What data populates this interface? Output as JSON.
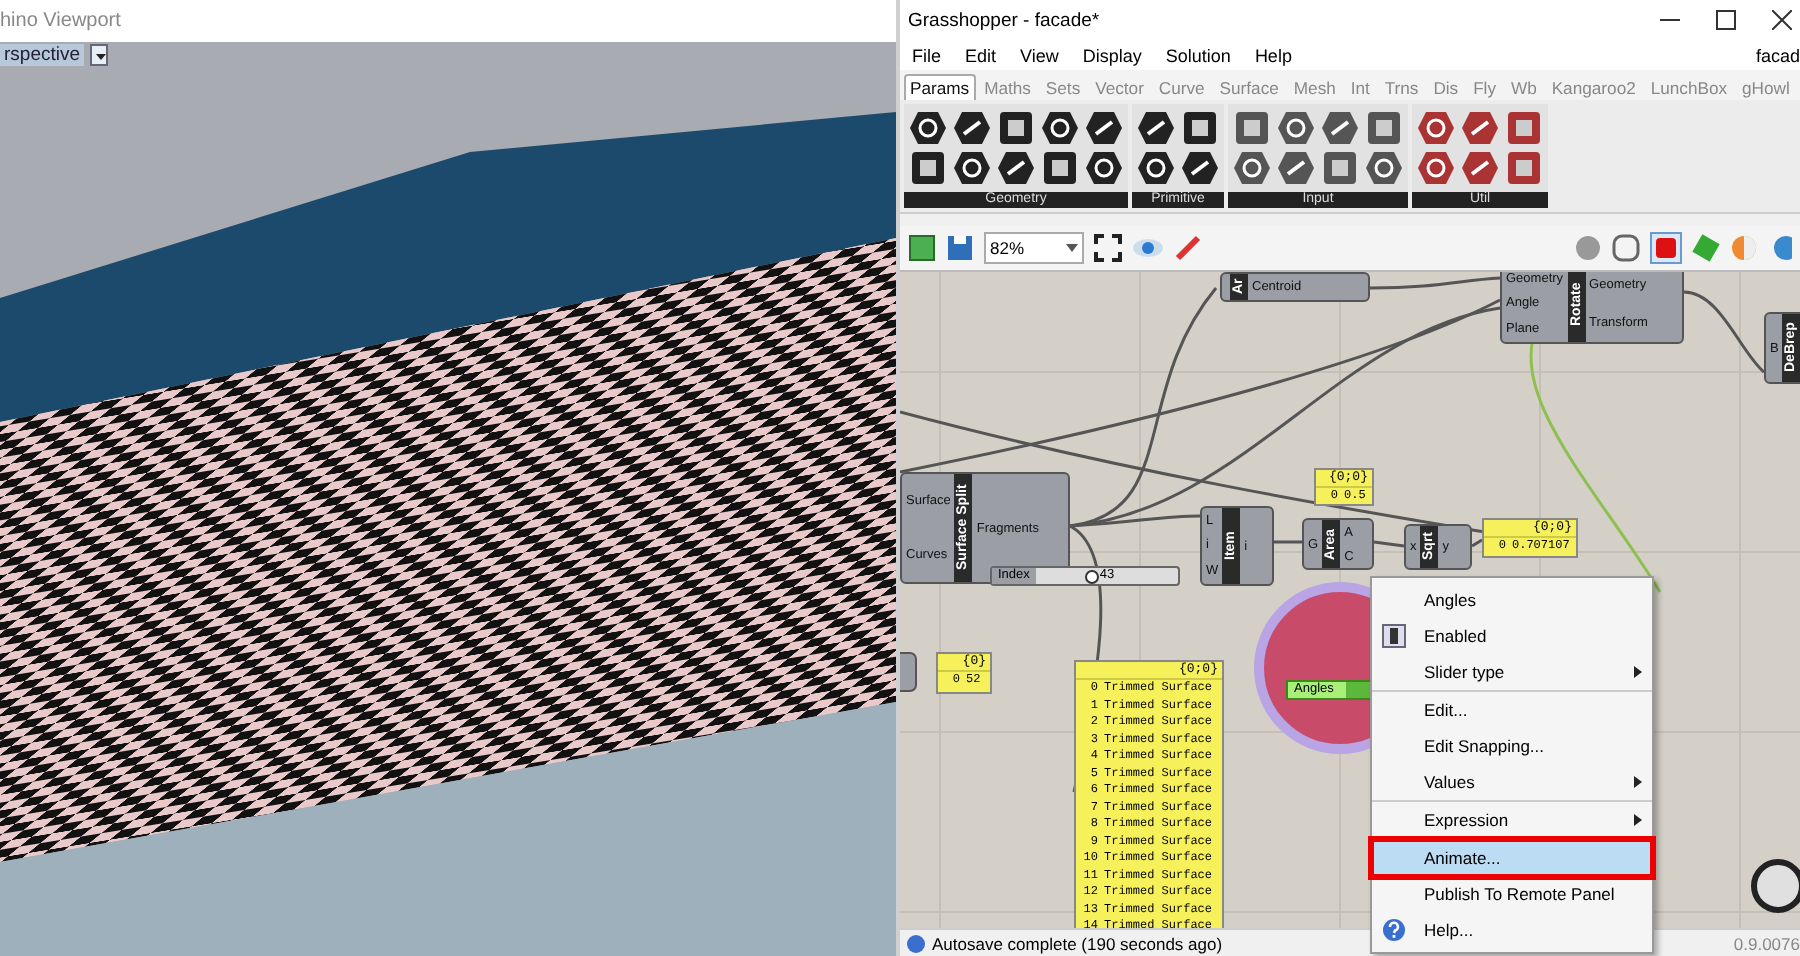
{
  "viewport": {
    "title": "hino Viewport",
    "view_label": "rspective"
  },
  "window": {
    "title": "Grasshopper - facade*"
  },
  "menu_bar": {
    "items": [
      "File",
      "Edit",
      "View",
      "Display",
      "Solution",
      "Help"
    ],
    "document": "facad"
  },
  "tabs": [
    {
      "label": "Params",
      "selected": true
    },
    {
      "label": "Maths",
      "selected": false
    },
    {
      "label": "Sets",
      "selected": false
    },
    {
      "label": "Vector",
      "selected": false
    },
    {
      "label": "Curve",
      "selected": false
    },
    {
      "label": "Surface",
      "selected": false
    },
    {
      "label": "Mesh",
      "selected": false
    },
    {
      "label": "Int",
      "selected": false
    },
    {
      "label": "Trns",
      "selected": false
    },
    {
      "label": "Dis",
      "selected": false
    },
    {
      "label": "Fly",
      "selected": false
    },
    {
      "label": "Wb",
      "selected": false
    },
    {
      "label": "Kangaroo2",
      "selected": false
    },
    {
      "label": "LunchBox",
      "selected": false
    },
    {
      "label": "gHowl",
      "selected": false
    }
  ],
  "ribbon_groups": [
    {
      "label": "Geometry"
    },
    {
      "label": "Primitive"
    },
    {
      "label": "Input"
    },
    {
      "label": "Util"
    }
  ],
  "toolbar": {
    "zoom": "82%"
  },
  "components": [
    {
      "name": "Ar",
      "outputs": [
        "Centroid"
      ]
    },
    {
      "name": "Rotate",
      "inputs": [
        "Geometry",
        "Angle",
        "Plane"
      ],
      "outputs": [
        "Geometry",
        "Transform"
      ]
    },
    {
      "name": "DeBrep",
      "inputs": [
        "B"
      ]
    },
    {
      "name": "Surface Split",
      "inputs": [
        "Surface",
        "Curves"
      ],
      "outputs": [
        "Fragments"
      ]
    },
    {
      "name": "Item",
      "inputs": [
        "L",
        "i",
        "W"
      ],
      "outputs": [
        "i"
      ]
    },
    {
      "name": "Area",
      "inputs": [
        "G"
      ],
      "outputs": [
        "A",
        "C"
      ]
    },
    {
      "name": "Sqrt",
      "inputs": [
        "x"
      ],
      "outputs": [
        "y"
      ]
    }
  ],
  "slider": {
    "label": "Index",
    "value": "43",
    "level": 0.4
  },
  "panels": [
    {
      "header": "{0;0}",
      "rows": [
        {
          "index": "0",
          "text": "0.5"
        }
      ]
    },
    {
      "header": "{0;0}",
      "rows": [
        {
          "index": "0",
          "text": "0.707107"
        }
      ]
    },
    {
      "header": "{0}",
      "rows": [
        {
          "index": "0",
          "text": "52"
        }
      ]
    },
    {
      "header": "{0;0}",
      "rows": [
        {
          "index": "0",
          "text": "Trimmed Surface"
        },
        {
          "index": "1",
          "text": "Trimmed Surface"
        },
        {
          "index": "2",
          "text": "Trimmed Surface"
        },
        {
          "index": "3",
          "text": "Trimmed Surface"
        },
        {
          "index": "4",
          "text": "Trimmed Surface"
        },
        {
          "index": "5",
          "text": "Trimmed Surface"
        },
        {
          "index": "6",
          "text": "Trimmed Surface"
        },
        {
          "index": "7",
          "text": "Trimmed Surface"
        },
        {
          "index": "8",
          "text": "Trimmed Surface"
        },
        {
          "index": "9",
          "text": "Trimmed Surface"
        },
        {
          "index": "10",
          "text": "Trimmed Surface"
        },
        {
          "index": "11",
          "text": "Trimmed Surface"
        },
        {
          "index": "12",
          "text": "Trimmed Surface"
        },
        {
          "index": "13",
          "text": "Trimmed Surface"
        },
        {
          "index": "14",
          "text": "Trimmed Surface"
        }
      ]
    }
  ],
  "angle_slider": {
    "label": "Angles",
    "level": 0.6
  },
  "context_menu": {
    "sections": [
      [
        {
          "kind": "name",
          "label": "Angles",
          "selected": false,
          "submenu": false
        },
        {
          "kind": "toggle",
          "label": "Enabled",
          "checked": true,
          "selected": false,
          "submenu": false
        },
        {
          "kind": "item",
          "label": "Slider type",
          "selected": false,
          "submenu": true
        }
      ],
      [
        {
          "kind": "item",
          "label": "Edit...",
          "selected": false,
          "submenu": false
        },
        {
          "kind": "item",
          "label": "Edit Snapping...",
          "selected": false,
          "submenu": false
        },
        {
          "kind": "item",
          "label": "Values",
          "selected": false,
          "submenu": true
        }
      ],
      [
        {
          "kind": "item",
          "label": "Expression",
          "selected": false,
          "submenu": true
        }
      ],
      [
        {
          "kind": "item",
          "label": "Animate...",
          "selected": true,
          "submenu": false
        },
        {
          "kind": "item",
          "label": "Publish To Remote Panel",
          "selected": false,
          "submenu": false
        },
        {
          "kind": "help",
          "label": "Help...",
          "selected": false,
          "submenu": false
        }
      ]
    ]
  },
  "status_bar": {
    "message": "Autosave complete (190 seconds ago)",
    "version": "0.9.0076"
  }
}
